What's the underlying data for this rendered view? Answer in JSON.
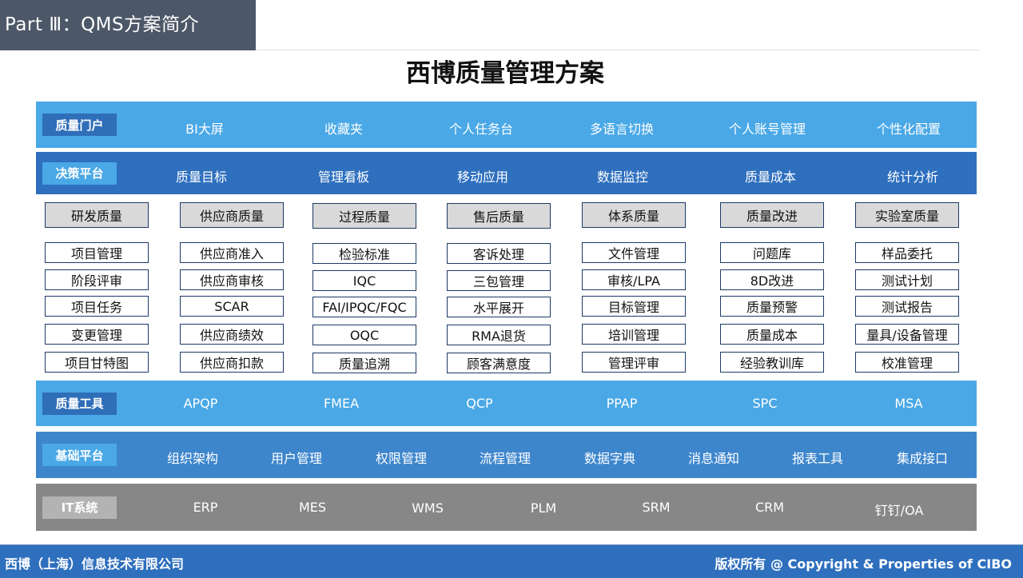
{
  "header": {
    "section": "Part Ⅲ：QMS方案简介"
  },
  "title": "西博质量管理方案",
  "portal": {
    "tag": "质量门户",
    "items": [
      "BI大屏",
      "收藏夹",
      "个人任务台",
      "多语言切换",
      "个人账号管理",
      "个性化配置"
    ]
  },
  "decision": {
    "tag": "决策平台",
    "items": [
      "质量目标",
      "管理看板",
      "移动应用",
      "数据监控",
      "质量成本",
      "统计分析"
    ]
  },
  "modules": [
    {
      "name": "研发质量",
      "items": [
        "项目管理",
        "阶段评审",
        "项目任务",
        "变更管理",
        "项目甘特图"
      ]
    },
    {
      "name": "供应商质量",
      "items": [
        "供应商准入",
        "供应商审核",
        "SCAR",
        "供应商绩效",
        "供应商扣款"
      ]
    },
    {
      "name": "过程质量",
      "items": [
        "检验标准",
        "IQC",
        "FAI/IPQC/FQC",
        "OQC",
        "质量追溯"
      ]
    },
    {
      "name": "售后质量",
      "items": [
        "客诉处理",
        "三包管理",
        "水平展开",
        "RMA退货",
        "顾客满意度"
      ]
    },
    {
      "name": "体系质量",
      "items": [
        "文件管理",
        "审核/LPA",
        "目标管理",
        "培训管理",
        "管理评审"
      ]
    },
    {
      "name": "质量改进",
      "items": [
        "问题库",
        "8D改进",
        "质量预警",
        "质量成本",
        "经验教训库"
      ]
    },
    {
      "name": "实验室质量",
      "items": [
        "样品委托",
        "测试计划",
        "测试报告",
        "量具/设备管理",
        "校准管理"
      ]
    }
  ],
  "tools": {
    "tag": "质量工具",
    "items": [
      "APQP",
      "FMEA",
      "QCP",
      "PPAP",
      "SPC",
      "MSA"
    ]
  },
  "base": {
    "tag": "基础平台",
    "items": [
      "组织架构",
      "用户管理",
      "权限管理",
      "流程管理",
      "数据字典",
      "消息通知",
      "报表工具",
      "集成接口"
    ]
  },
  "it": {
    "tag": "IT系统",
    "items": [
      "ERP",
      "MES",
      "WMS",
      "PLM",
      "SRM",
      "CRM",
      "钉钉/OA"
    ]
  },
  "footer": {
    "company": "西博（上海）信息技术有限公司",
    "copyright": "版权所有 @  Copyright & Properties of CIBO"
  },
  "colors": {
    "dark_blue": "#2e6fbe",
    "light_blue": "#4aa8e6",
    "gray": "#878787",
    "border": "#1c3a66"
  }
}
